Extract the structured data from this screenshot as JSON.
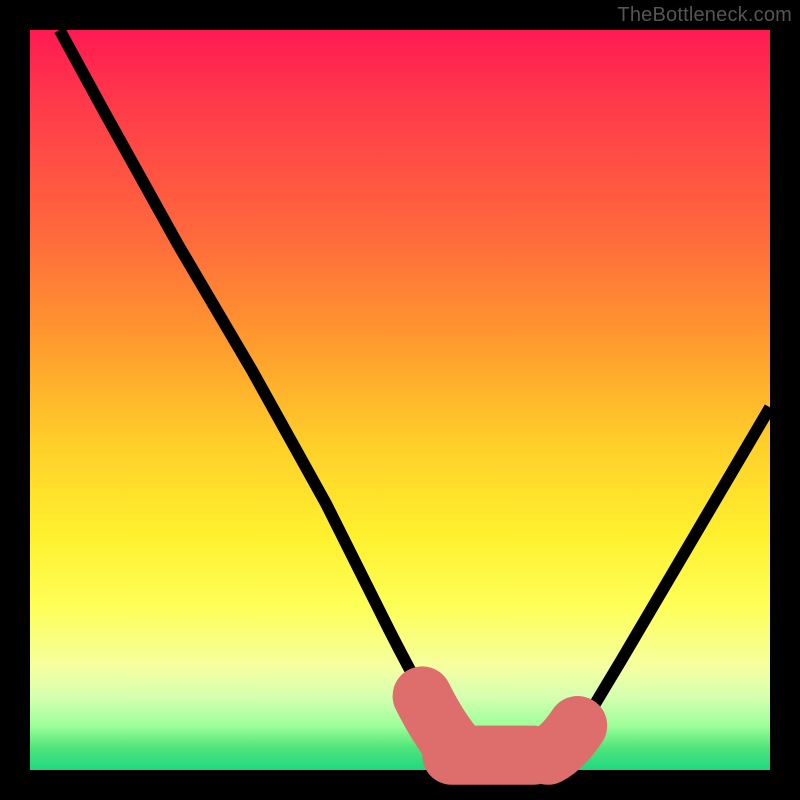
{
  "watermark": "TheBottleneck.com",
  "colors": {
    "frame": "#000000",
    "curve": "#000000",
    "accent": "#de6e6c"
  },
  "chart_data": {
    "type": "line",
    "title": "",
    "xlabel": "",
    "ylabel": "",
    "xlim": [
      0,
      100
    ],
    "ylim": [
      0,
      100
    ],
    "grid": false,
    "legend": false,
    "series": [
      {
        "name": "curve",
        "x": [
          4,
          10,
          20,
          30,
          40,
          48,
          53,
          57,
          60,
          65,
          70,
          80,
          90,
          100
        ],
        "y": [
          100,
          89,
          71,
          54,
          36,
          20,
          10,
          4,
          1,
          1,
          1,
          15,
          32,
          49
        ]
      }
    ],
    "annotations": [
      {
        "name": "bottleneck-plateau-left-dash",
        "x_range": [
          53,
          57
        ],
        "style": "dashed-accent"
      },
      {
        "name": "bottleneck-plateau-flat-dash",
        "x_range": [
          57,
          70
        ],
        "style": "dashed-accent"
      },
      {
        "name": "bottleneck-plateau-right-dash",
        "x_range": [
          70,
          74
        ],
        "style": "dashed-accent"
      }
    ]
  }
}
